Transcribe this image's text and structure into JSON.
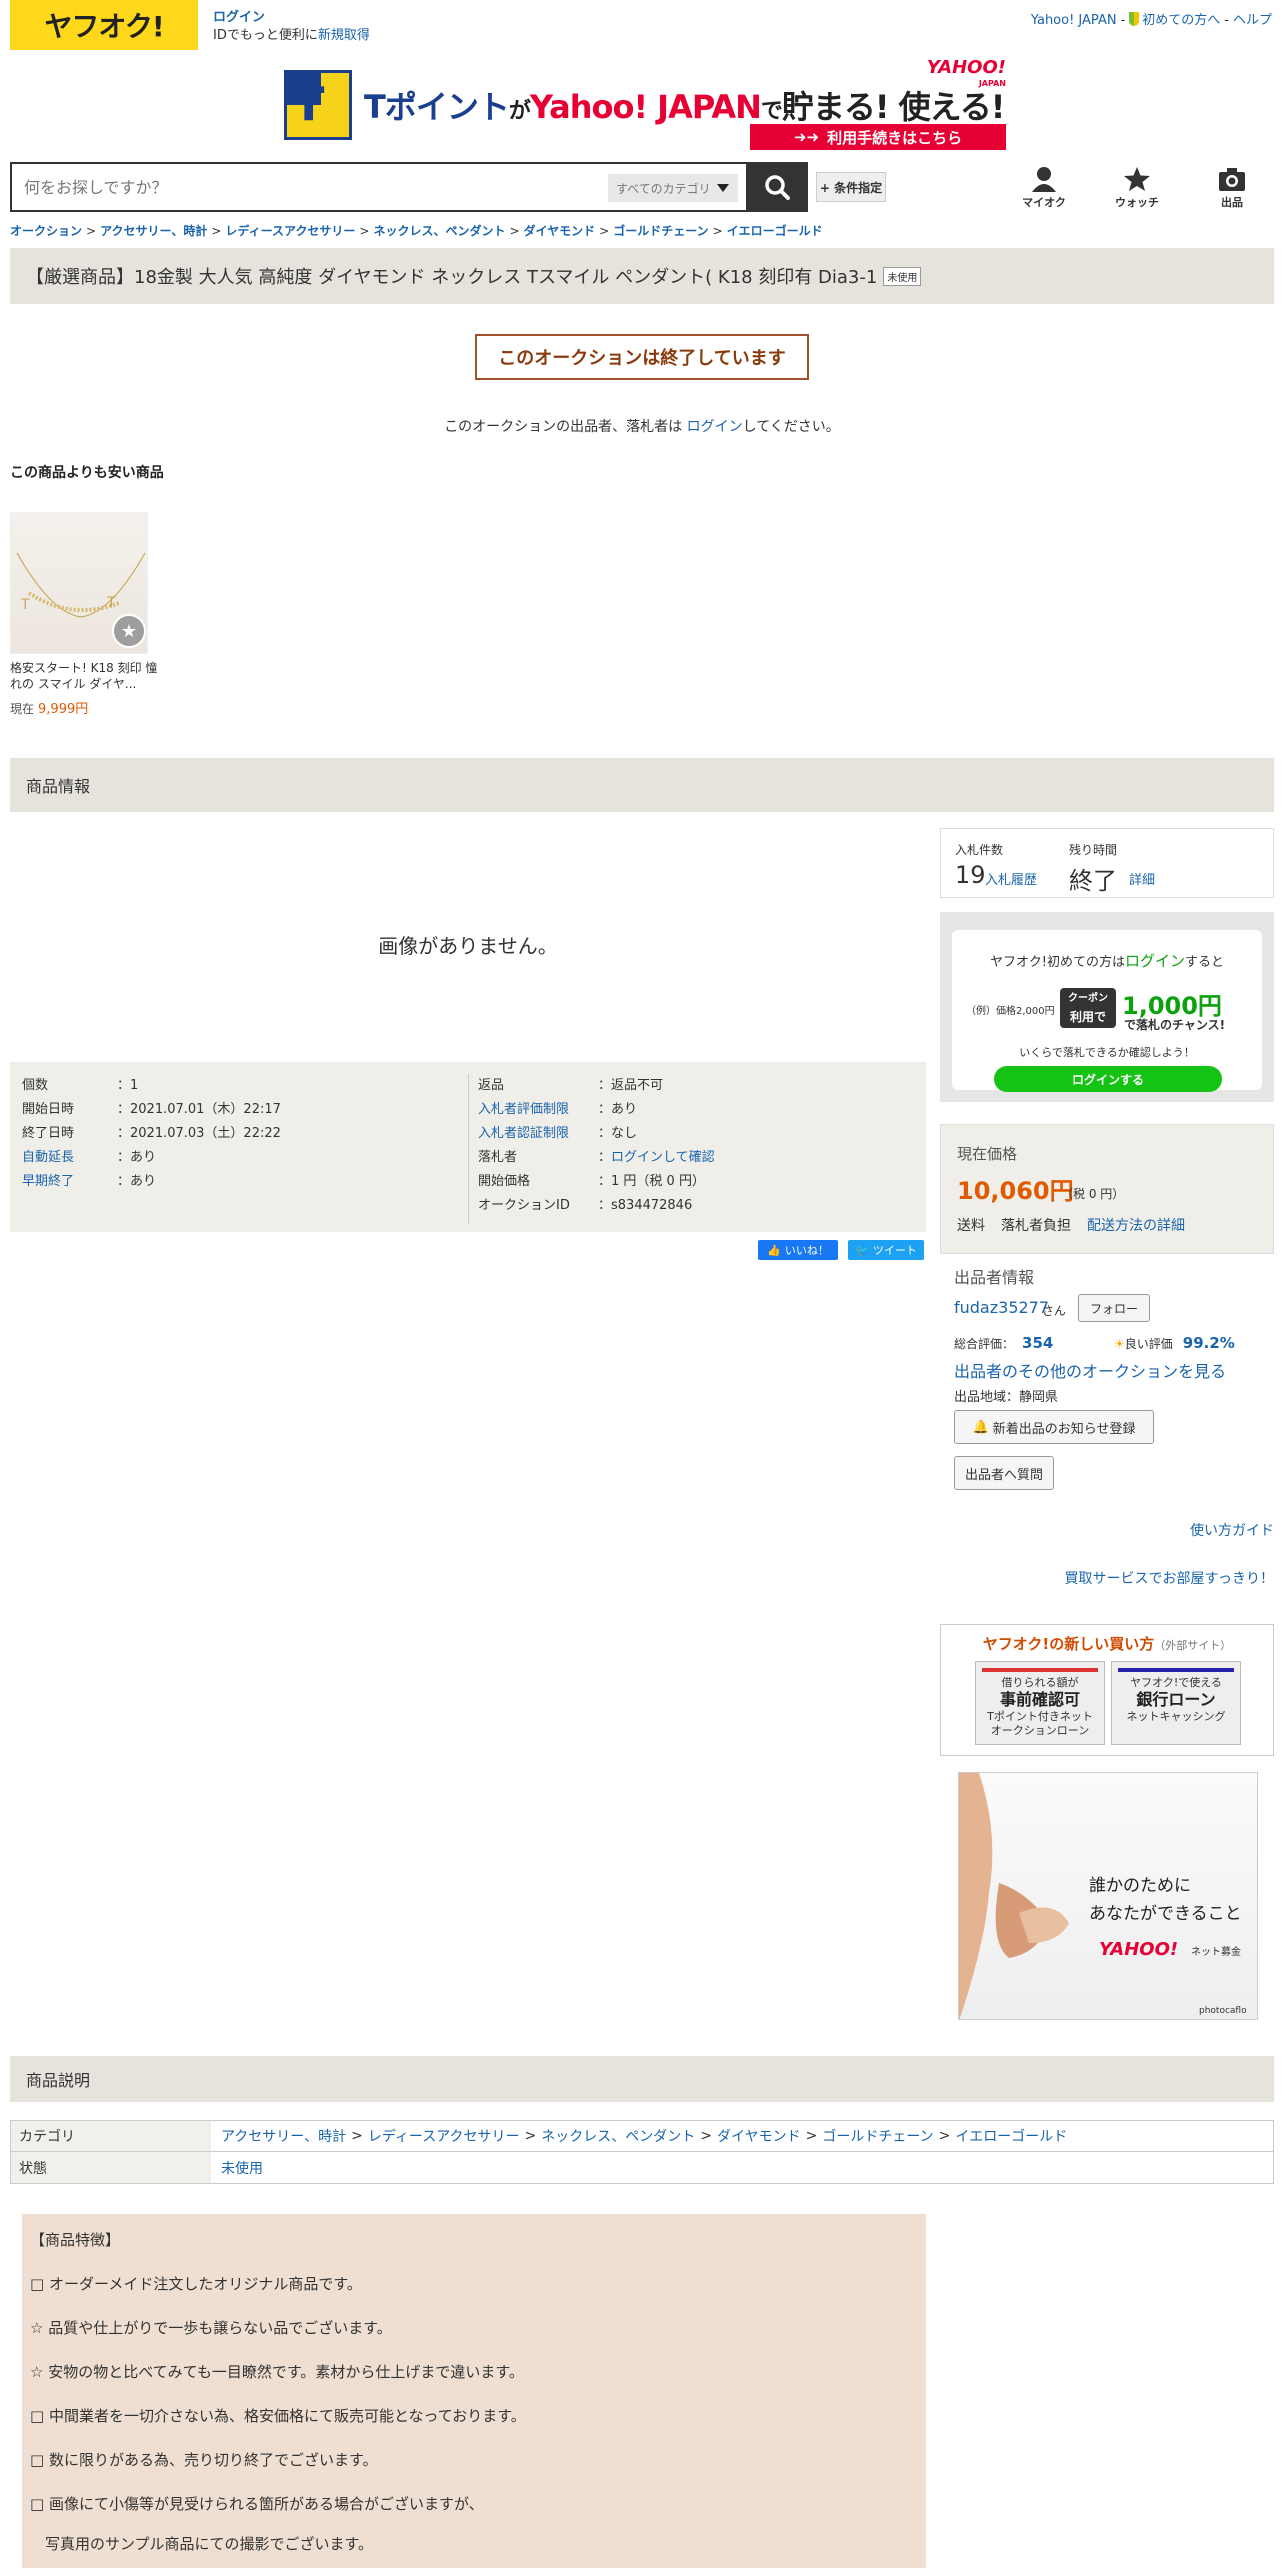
{
  "header": {
    "logo": "ヤフオク!",
    "login": "ログイン",
    "login_sub": "IDでもっと便利に",
    "signup": "新規取得",
    "top_links": [
      "Yahoo! JAPAN",
      "初めての方へ",
      "ヘルプ"
    ]
  },
  "banner": {
    "t1": "Tポイント",
    "t2": "が",
    "t3": "Yahoo! JAPAN",
    "t4": "で",
    "t5": "貯まる! 使える!",
    "yahoo": "YAHOO!",
    "japan": "JAPAN",
    "button": "利用手続きはこちら"
  },
  "search": {
    "placeholder": "何をお探しですか？",
    "category": "すべてのカテゴリ",
    "cond_button": "+ 条件指定"
  },
  "nav": {
    "myauc": "マイオク",
    "watch": "ウォッチ",
    "sell": "出品"
  },
  "breadcrumb": [
    "オークション",
    "アクセサリー、時計",
    "レディースアクセサリー",
    "ネックレス、ペンダント",
    "ダイヤモンド",
    "ゴールドチェーン",
    "イエローゴールド"
  ],
  "item": {
    "title": "【厳選商品】18金製 大人気 高純度 ダイヤモンド ネックレス Tスマイル ペンダント( K18 刻印有 Dia3-1",
    "condition_badge": "未使用"
  },
  "ended_text": "このオークションは終了しています",
  "login_msg": {
    "pre": "このオークションの出品者、落札者は ",
    "link": "ログイン",
    "post": "してください。"
  },
  "cheaper": {
    "heading": "この商品よりも安い商品",
    "title": "格安スタート! K18 刻印 憧れの スマイル ダイヤ...",
    "price_label": "現在",
    "price": "9,999円"
  },
  "sections": {
    "info": "商品情報",
    "desc": "商品説明"
  },
  "no_image": "画像がありません。",
  "details_left": [
    {
      "k": "個数",
      "v": "：1"
    },
    {
      "k": "開始日時",
      "v": "：2021.07.01（木）22:17"
    },
    {
      "k": "終了日時",
      "v": "：2021.07.03（土）22:22"
    },
    {
      "k": "自動延長",
      "v": "：あり"
    },
    {
      "k": "早期終了",
      "v": "：あり"
    }
  ],
  "details_right": [
    {
      "k": "返品",
      "v": "：返品不可"
    },
    {
      "k": "入札者評価制限",
      "v": "：あり"
    },
    {
      "k": "入札者認証制限",
      "v": "：なし"
    },
    {
      "k": "落札者",
      "v": "：",
      "v2": "ログインして確認"
    },
    {
      "k": "開始価格",
      "v": "：1 円（税 0 円）"
    },
    {
      "k": "オークションID",
      "v": "：s834472846"
    }
  ],
  "social": {
    "like": "いいね！",
    "tweet": "ツイート"
  },
  "bids": {
    "count_label": "入札件数",
    "count": "19",
    "history": "入札履歴",
    "time_label": "残り時間",
    "time": "終了",
    "detail": "詳細"
  },
  "promo": {
    "line1_pre": "ヤフオク!初めての方は",
    "line1_link": "ログイン",
    "line1_post": "すると",
    "example": "（例）価格2,000円",
    "coupon1": "クーポン",
    "coupon2": "利用で",
    "amount": "1,000円",
    "amount_sub": "で落札のチャンス!",
    "line3": "いくらで落札できるか確認しよう！",
    "button": "ログインする"
  },
  "price": {
    "label": "現在価格",
    "value": "10,060円",
    "tax": "（税 0 円）",
    "ship_label": "送料",
    "ship_value": "落札者負担",
    "ship_link": "配送方法の詳細"
  },
  "seller": {
    "heading": "出品者情報",
    "name": "fudaz35277",
    "san": "さん",
    "follow": "フォロー",
    "rating_label": "総合評価：",
    "rating": "354",
    "good_label": "良い評価",
    "good": "99.2%",
    "other": "出品者のその他のオークションを見る",
    "region": "出品地域：静岡県",
    "notify": "新着出品のお知らせ登録",
    "ask": "出品者へ質問"
  },
  "guide": "使い方ガイド",
  "buyback": "買取サービスでお部屋すっきり！",
  "newbuy": {
    "title": "ヤフオク!の新しい買い方",
    "title_sub": "（外部サイト）",
    "c1_top": "借りられる額が",
    "c1_main": "事前確認可",
    "c1_sub1": "Tポイント付きネット",
    "c1_sub2": "オークションローン",
    "c2_top": "ヤフオク!で使える",
    "c2_main": "銀行ローン",
    "c2_sub": "ネットキャッシング"
  },
  "ad": {
    "line1": "誰かのために",
    "line2": "あなたができること",
    "brand": "YAHOO!",
    "brand_sub": "ネット募金",
    "credit": "photocaflo"
  },
  "category_table": {
    "cat_label": "カテゴリ",
    "cats": [
      "アクセサリー、時計",
      "レディースアクセサリー",
      "ネックレス、ペンダント",
      "ダイヤモンド",
      "ゴールドチェーン",
      "イエローゴールド"
    ],
    "state_label": "状態",
    "state": "未使用"
  },
  "description": [
    "【商品特徴】",
    "□ オーダーメイド注文したオリジナル商品です。",
    "☆ 品質や仕上がりで一歩も譲らない品でございます。",
    "☆ 安物の物と比べてみても一目瞭然です。素材から仕上げまで違います。",
    "□ 中間業者を一切介さない為、格安価格にて販売可能となっております。",
    "□ 数に限りがある為、売り切り終了でございます。",
    "□ 画像にて小傷等が見受けられる箇所がある場合がございますが、",
    "　写真用のサンプル商品にての撮影でございます。"
  ],
  "colors": {
    "yahoo_yellow": "#ffd71b",
    "link": "#1a64ad",
    "price": "#e05a00",
    "panel": "#e5e3db"
  }
}
